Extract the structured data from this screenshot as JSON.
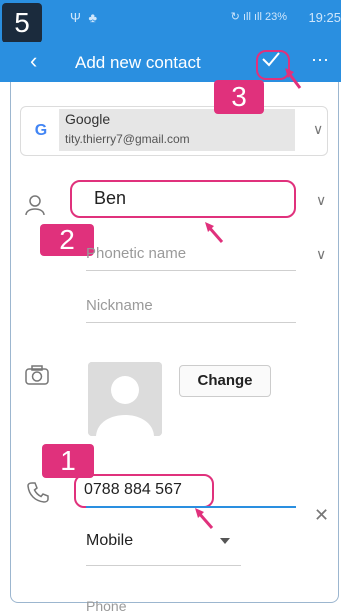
{
  "status_bar": {
    "step_label": "5",
    "signal_icons": "Ψ ♣",
    "sync": "↻",
    "signal": "ıll ıll",
    "battery": "23%",
    "time": "19:25"
  },
  "header": {
    "back_icon": "chevron-left-icon",
    "title": "Add new contact",
    "confirm_icon": "check-icon",
    "more_icon": "more-icon"
  },
  "account": {
    "name": "Google",
    "email": "tity.thierry7@gmail.com"
  },
  "form": {
    "name_value": "Ben",
    "phonetic_placeholder": "Phonetic name",
    "nickname_placeholder": "Nickname",
    "change_label": "Change",
    "phone_value": "0788 884 567",
    "phone_type": "Mobile",
    "next_placeholder": "Phone"
  },
  "annotations": {
    "badge_1": "1",
    "badge_2": "2",
    "badge_3": "3"
  },
  "colors": {
    "primary": "#2a8fe0",
    "highlight": "#e0317c"
  }
}
